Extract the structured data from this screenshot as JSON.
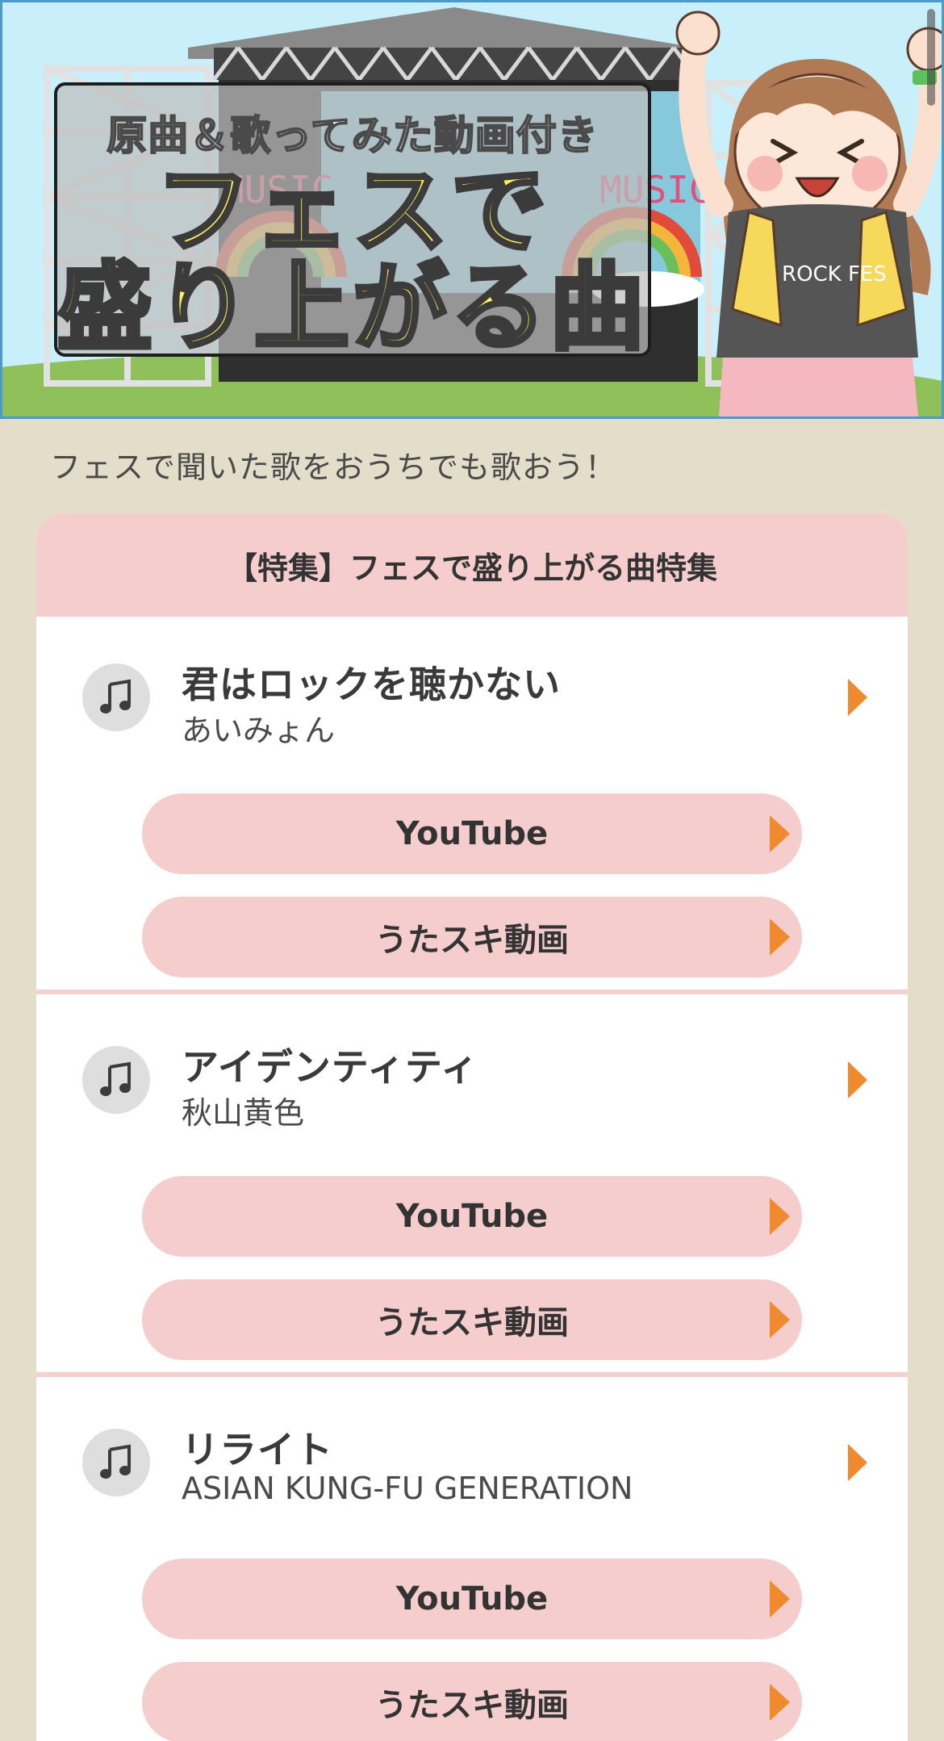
{
  "banner": {
    "subtitle": "原曲＆歌ってみた動画付き",
    "title_line1": "フェスで",
    "title_line2": "盛り上がる曲",
    "stage_sign_left": "MUSIC",
    "stage_sign_right": "MUSIC",
    "shirt_text": "ROCK FES"
  },
  "lead_text": "フェスで聞いた歌をおうちでも歌おう！",
  "card": {
    "header": "【特集】フェスで盛り上がる曲特集"
  },
  "songs": [
    {
      "title": "君はロックを聴かない",
      "artist": "あいみょん",
      "youtube_label": "YouTube",
      "utasuki_label": "うたスキ動画"
    },
    {
      "title": "アイデンティティ",
      "artist": "秋山黄色",
      "youtube_label": "YouTube",
      "utasuki_label": "うたスキ動画"
    },
    {
      "title": "リライト",
      "artist": "ASIAN KUNG-FU GENERATION",
      "youtube_label": "YouTube",
      "utasuki_label": "うたスキ動画"
    }
  ],
  "colors": {
    "page_bg": "#e3ddca",
    "accent_pink": "#f6cdcd",
    "arrow_orange": "#ef8a2e",
    "banner_title_yellow": "#fff25a"
  }
}
